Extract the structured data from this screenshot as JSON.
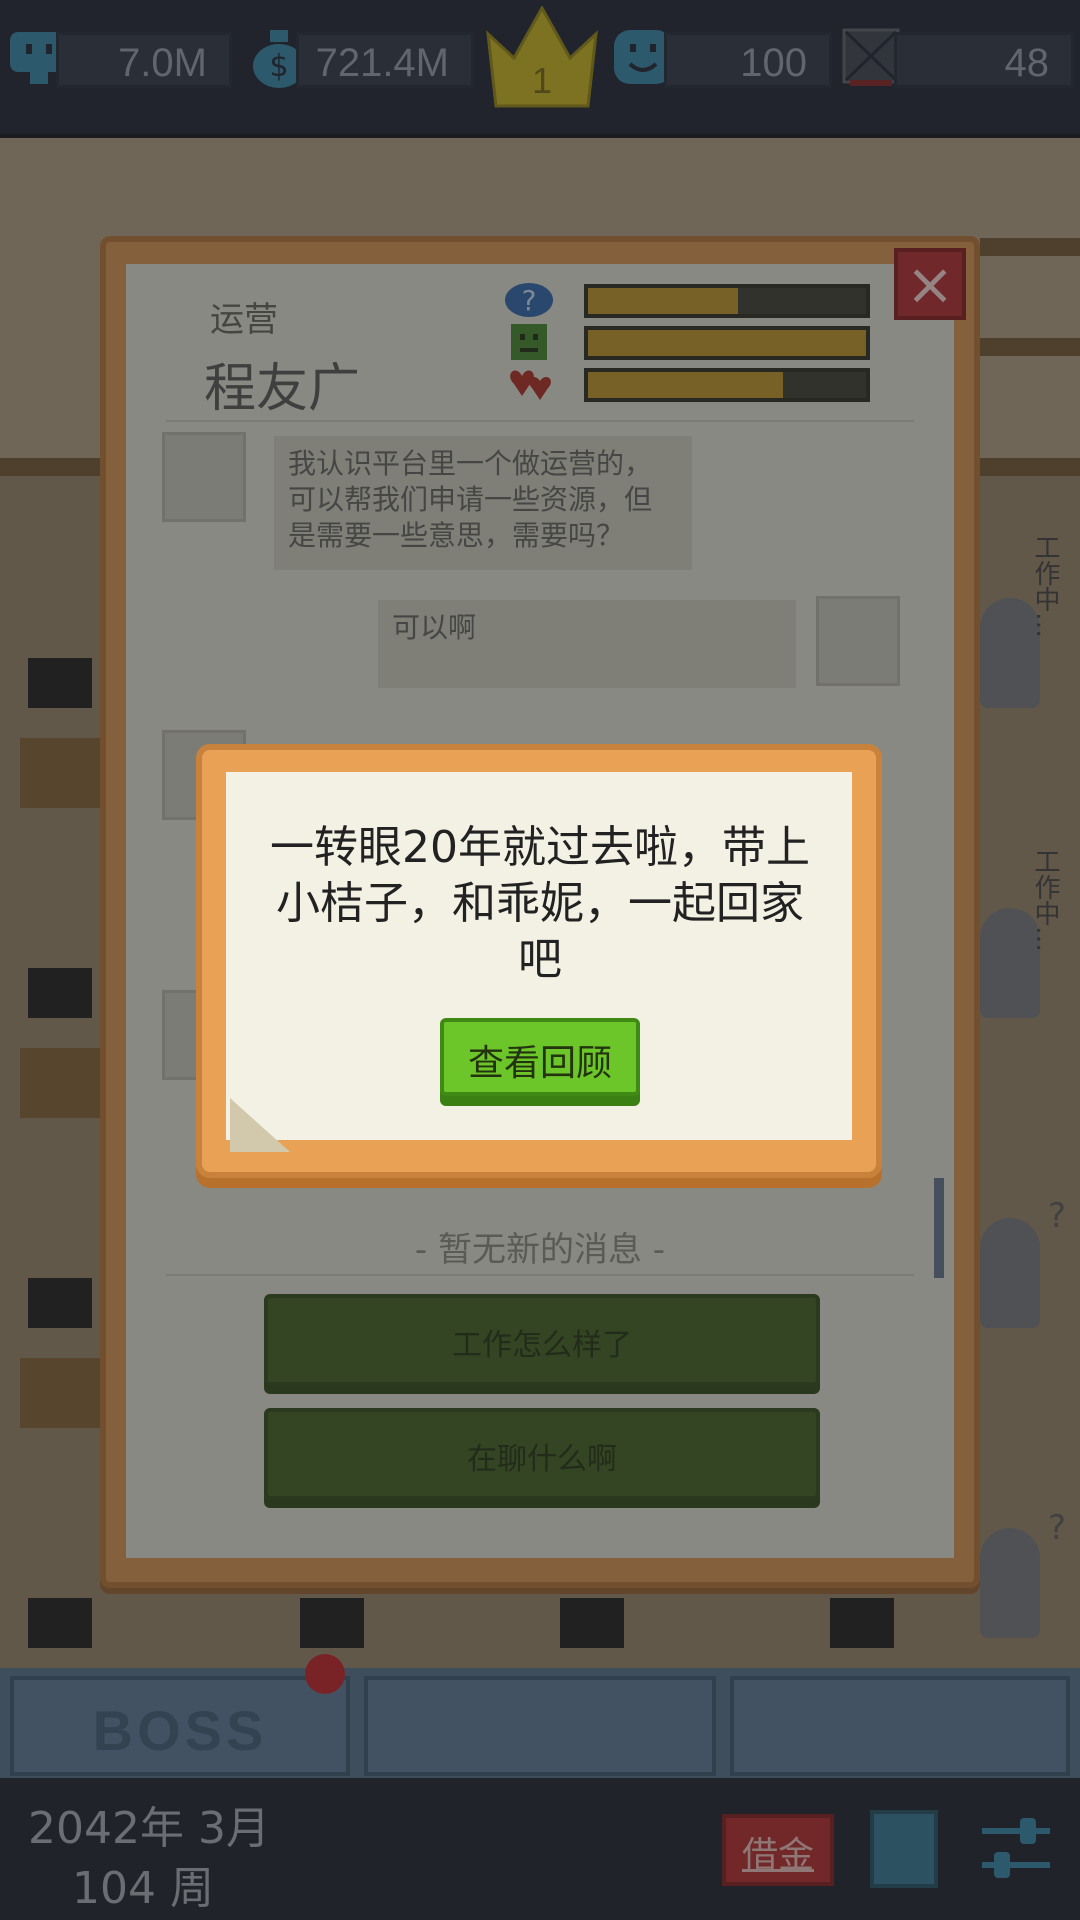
{
  "resources": {
    "followers": "7.0M",
    "money": "721.4M",
    "level": "1",
    "mood": "100",
    "tasks": "48"
  },
  "icons": {
    "followers": "monitor-icon",
    "money": "money-bag-icon",
    "level": "crown-icon",
    "mood": "smiley-icon",
    "tasks": "crossed-box-icon"
  },
  "chat": {
    "role": "运营",
    "name": "程友广",
    "stats": [
      {
        "icon": "question-bubble-icon",
        "fill": 0.54
      },
      {
        "icon": "happy-face-icon",
        "fill": 1.0
      },
      {
        "icon": "hearts-icon",
        "fill": 0.7
      }
    ],
    "messages": [
      {
        "from": "npc",
        "text": "我认识平台里一个做运营的，可以帮我们申请一些资源，但是需要一些意思，需要吗？"
      },
      {
        "from": "player",
        "text": "可以啊"
      }
    ],
    "no_messages": "- 暂无新的消息 -",
    "replies": [
      "工作怎么样了",
      "在聊什么啊"
    ],
    "close": "×"
  },
  "event": {
    "message": "一转眼20年就过去啦，带上小桔子，和乖妮，一起回家吧",
    "button": "查看回顾"
  },
  "bottom_nav": {
    "tabs": [
      "BOSS",
      "",
      ""
    ]
  },
  "office": {
    "status_label": "工作中…"
  },
  "footer": {
    "date": "2042年 3月",
    "week": "104 周",
    "loan": "借金"
  },
  "colors": {
    "event_border": "#e8a155",
    "review_button": "#6cc629",
    "close_button": "#a6292b",
    "stat_fill": "#b08a26"
  }
}
